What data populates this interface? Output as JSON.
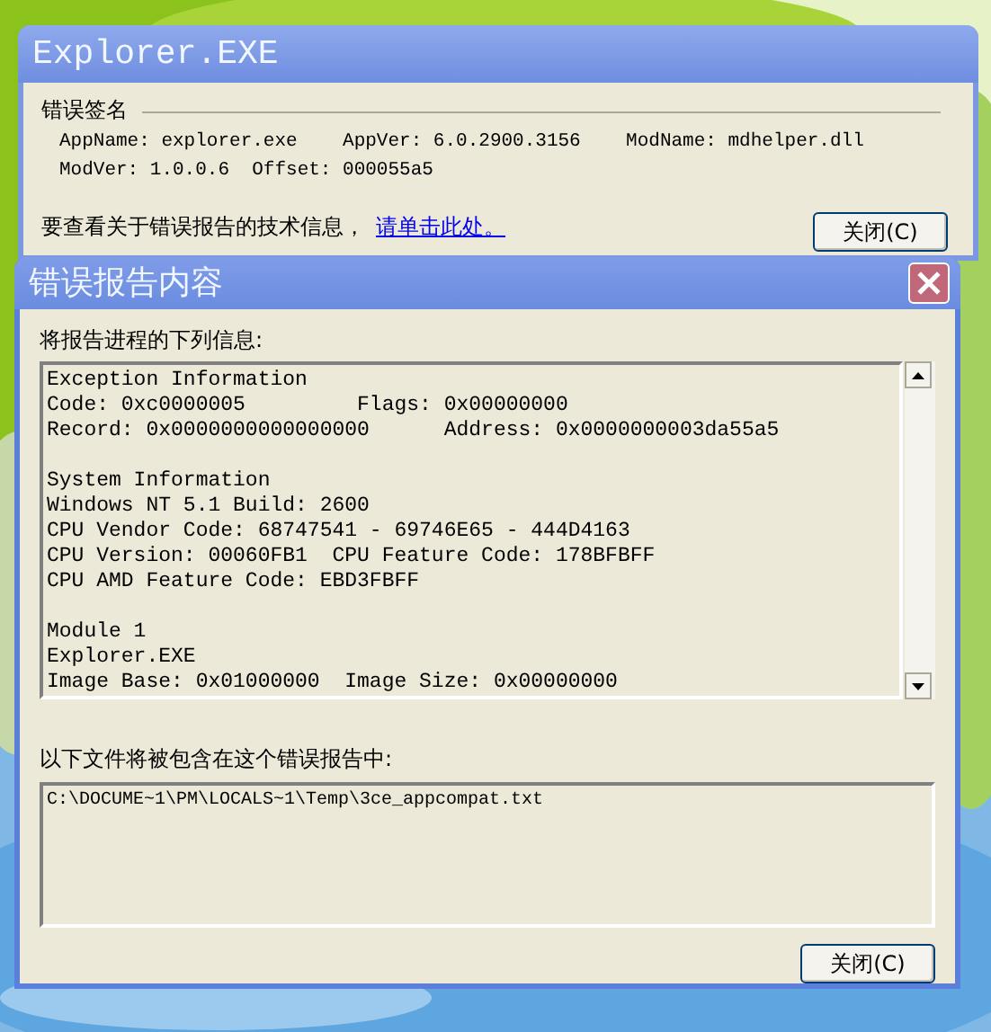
{
  "signature_window": {
    "title": "Explorer.EXE",
    "group_label": "错误签名",
    "details": [
      "AppName: explorer.exe    AppVer: 6.0.2900.3156    ModName: mdhelper.dll",
      "ModVer: 1.0.0.6  Offset: 000055a5"
    ],
    "info_text": "要查看关于错误报告的技术信息，",
    "info_link": "请单击此处。",
    "close_button": "关闭(C)"
  },
  "report_window": {
    "title": "错误报告内容",
    "report_label": "将报告进程的下列信息:",
    "report_sections": [
      [
        "Exception Information",
        "Code: 0xc0000005         Flags: 0x00000000",
        "Record: 0x0000000000000000      Address: 0x0000000003da55a5"
      ],
      [
        "System Information",
        "Windows NT 5.1 Build: 2600",
        "CPU Vendor Code: 68747541 - 69746E65 - 444D4163",
        "CPU Version: 00060FB1  CPU Feature Code: 178BFBFF",
        "CPU AMD Feature Code: EBD3FBFF"
      ],
      [
        "Module 1",
        "Explorer.EXE",
        "Image Base: 0x01000000  Image Size: 0x00000000"
      ]
    ],
    "files_label": "以下文件将被包含在这个错误报告中:",
    "files": [
      "C:\\DOCUME~1\\PM\\LOCALS~1\\Temp\\3ce_appcompat.txt"
    ],
    "close_button": "关闭(C)"
  }
}
